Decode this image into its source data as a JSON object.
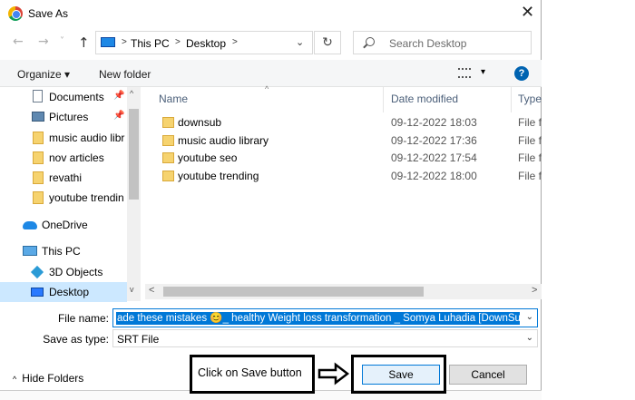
{
  "titlebar": {
    "title": "Save As",
    "close_glyph": "✕"
  },
  "nav": {
    "back": "←",
    "forward": "→",
    "recent": "˅",
    "up": "↑"
  },
  "address": {
    "separator": ">",
    "segments": [
      "This PC",
      "Desktop"
    ],
    "dropdown": "⌄",
    "refresh": "↻"
  },
  "search": {
    "placeholder": "Search Desktop"
  },
  "toolbar": {
    "organize": "Organize ▾",
    "new_folder": "New folder",
    "view_dropdown": "▾",
    "help": "?"
  },
  "navpane": {
    "items": [
      {
        "label": "Documents",
        "icon": "document-icon",
        "pinned": true
      },
      {
        "label": "Pictures",
        "icon": "pictures-icon",
        "pinned": true
      },
      {
        "label": "music audio libr",
        "icon": "folder-icon",
        "pinned": false
      },
      {
        "label": "nov articles",
        "icon": "folder-icon",
        "pinned": false
      },
      {
        "label": "revathi",
        "icon": "folder-icon",
        "pinned": false
      },
      {
        "label": "youtube trendin",
        "icon": "folder-icon",
        "pinned": false
      },
      {
        "label": "OneDrive",
        "icon": "onedrive-icon",
        "pinned": false
      },
      {
        "label": "This PC",
        "icon": "this-pc-icon",
        "pinned": false
      },
      {
        "label": "3D Objects",
        "icon": "3d-objects-icon",
        "pinned": false
      },
      {
        "label": "Desktop",
        "icon": "desktop-icon",
        "pinned": false,
        "selected": true
      }
    ],
    "pin_glyph": "📌"
  },
  "filelist": {
    "columns": [
      "Name",
      "Date modified",
      "Type"
    ],
    "sort_caret": "^",
    "rows": [
      {
        "name": "downsub",
        "date": "09-12-2022 18:03",
        "type": "File f"
      },
      {
        "name": "music audio library",
        "date": "09-12-2022 17:36",
        "type": "File f"
      },
      {
        "name": "youtube seo",
        "date": "09-12-2022 17:54",
        "type": "File f"
      },
      {
        "name": "youtube trending",
        "date": "09-12-2022 18:00",
        "type": "File f"
      }
    ]
  },
  "scroll": {
    "up": "^",
    "down": "v",
    "left": "<",
    "right": ">"
  },
  "form": {
    "file_name_label": "File name:",
    "file_name_value": "ade these mistakes 😊_ healthy Weight loss transformation _ Somya Luhadia [DownSub.",
    "save_as_type_label": "Save as type:",
    "save_as_type_value": "SRT File",
    "dropdown": "⌄"
  },
  "footer": {
    "hide_folders": "Hide Folders",
    "hide_caret": "^",
    "save": "Save",
    "cancel": "Cancel"
  },
  "annotation": {
    "callout": "Click on Save button"
  },
  "colors": {
    "accent": "#0078d7",
    "selection": "#cce8ff",
    "folder": "#f6d36f"
  }
}
